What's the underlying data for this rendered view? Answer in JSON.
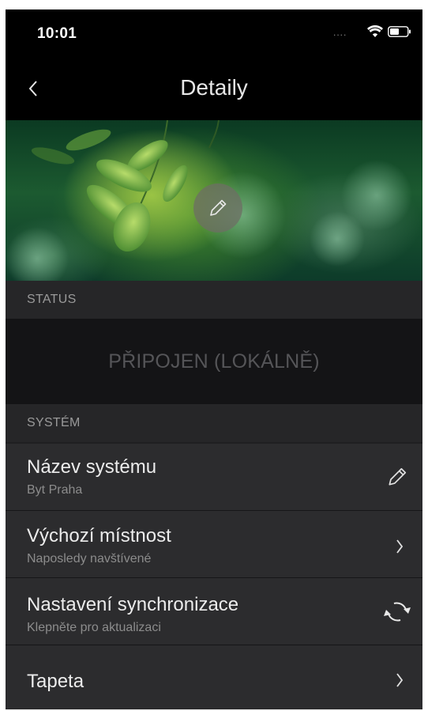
{
  "status_bar": {
    "time": "10:01",
    "signal": "....",
    "icons": [
      "wifi-icon",
      "battery-icon"
    ]
  },
  "nav": {
    "title": "Detaily",
    "back_icon": "chevron-left-icon"
  },
  "hero": {
    "edit_icon": "pencil-icon"
  },
  "sections": {
    "status_header": "STATUS",
    "status_value": "PŘIPOJEN (LOKÁLNĚ)",
    "system_header": "SYSTÉM"
  },
  "rows": [
    {
      "title": "Název systému",
      "subtitle": "Byt Praha",
      "icon": "pencil-icon"
    },
    {
      "title": "Výchozí místnost",
      "subtitle": "Naposledy navštívené",
      "icon": "chevron-right-icon"
    },
    {
      "title": "Nastavení synchronizace",
      "subtitle": "Klepněte pro aktualizaci",
      "icon": "sync-icon"
    },
    {
      "title": "Tapeta",
      "icon": "chevron-right-icon"
    }
  ],
  "colors": {
    "background": "#1f1f21",
    "row": "#2c2c2e",
    "header": "#262628",
    "status_box": "#141416",
    "text": "#ececec",
    "subtext": "#8c8c8c"
  }
}
